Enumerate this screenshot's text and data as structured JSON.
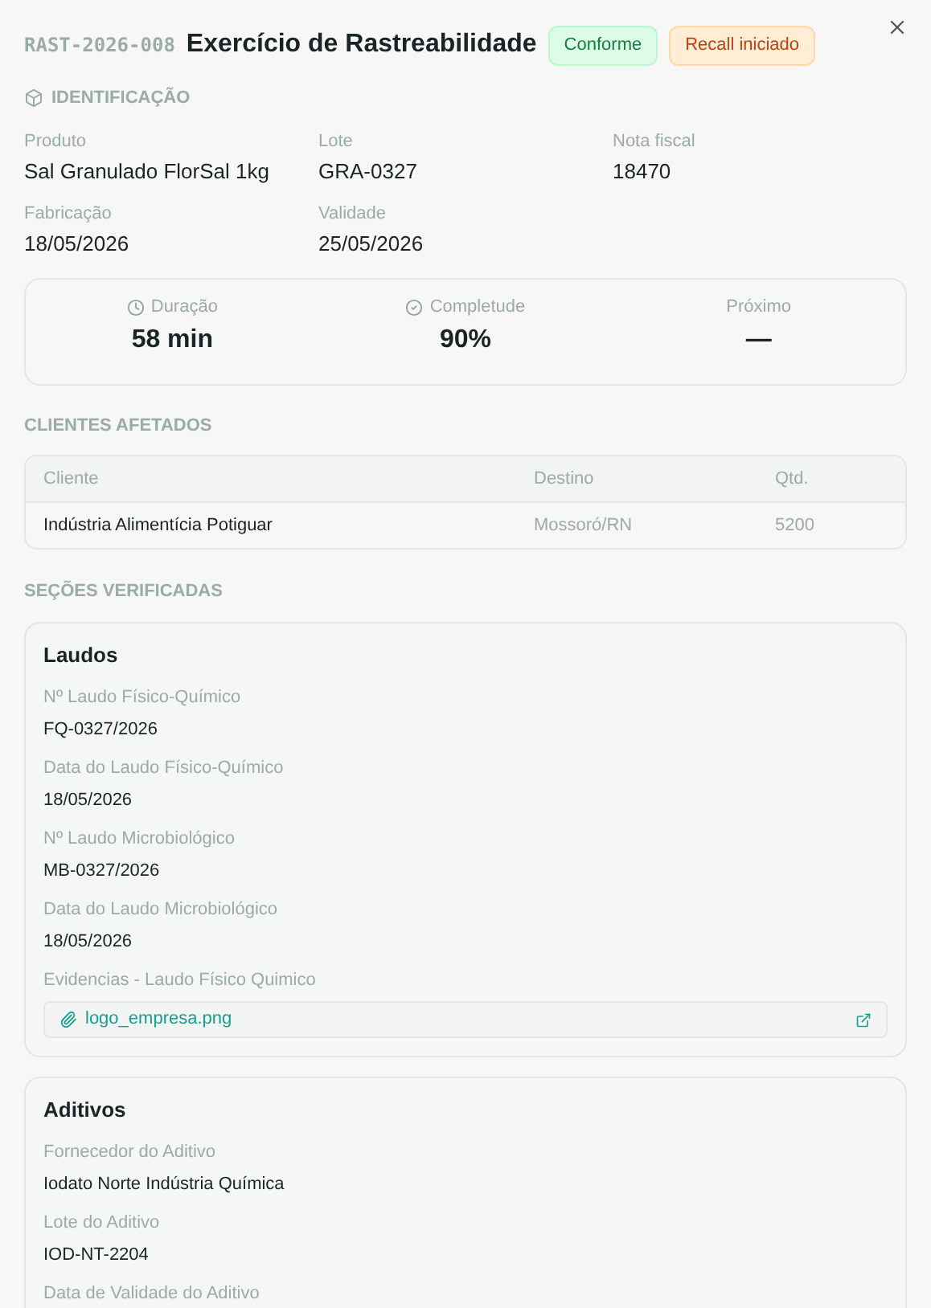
{
  "header": {
    "code": "RAST-2026-008",
    "title": "Exercício de Rastreabilidade",
    "badges": [
      {
        "label": "Conforme",
        "kind": "success"
      },
      {
        "label": "Recall iniciado",
        "kind": "warning"
      }
    ]
  },
  "identification": {
    "title": "IDENTIFICAÇÃO",
    "fields": [
      {
        "label": "Produto",
        "value": "Sal Granulado FlorSal 1kg"
      },
      {
        "label": "Lote",
        "value": "GRA-0327"
      },
      {
        "label": "Nota fiscal",
        "value": "18470"
      },
      {
        "label": "Fabricação",
        "value": "18/05/2026"
      },
      {
        "label": "Validade",
        "value": "25/05/2026"
      }
    ]
  },
  "stats": [
    {
      "label": "Duração",
      "value": "58 min",
      "kind": "duration"
    },
    {
      "label": "Completude",
      "value": "90%",
      "kind": "completeness"
    },
    {
      "label": "Próximo",
      "value": "—",
      "kind": "plain"
    }
  ],
  "clients": {
    "title": "CLIENTES AFETADOS",
    "columns": [
      "Cliente",
      "Destino",
      "Qtd."
    ],
    "rows": [
      [
        "Indústria Alimentícia Potiguar",
        "Mossoró/RN",
        "5200"
      ]
    ]
  },
  "sections_title": "SEÇÕES VERIFICADAS",
  "sections": [
    {
      "title": "Laudos",
      "fields": [
        {
          "kind": "text",
          "label": "Nº Laudo Físico-Químico",
          "value": "FQ-0327/2026"
        },
        {
          "kind": "text",
          "label": "Data do Laudo Físico-Químico",
          "value": "18/05/2026"
        },
        {
          "kind": "text",
          "label": "Nº Laudo Microbiológico",
          "value": "MB-0327/2026"
        },
        {
          "kind": "text",
          "label": "Data do Laudo Microbiológico",
          "value": "18/05/2026"
        },
        {
          "kind": "file",
          "label": "Evidencias - Laudo Físico Quimico",
          "value": "logo_empresa.png"
        }
      ]
    },
    {
      "title": "Aditivos",
      "fields": [
        {
          "kind": "text",
          "label": "Fornecedor do Aditivo",
          "value": "Iodato Norte Indústria Química"
        },
        {
          "kind": "text",
          "label": "Lote do Aditivo",
          "value": "IOD-NT-2204"
        },
        {
          "kind": "label",
          "label": "Data de Validade do Aditivo"
        }
      ]
    }
  ]
}
